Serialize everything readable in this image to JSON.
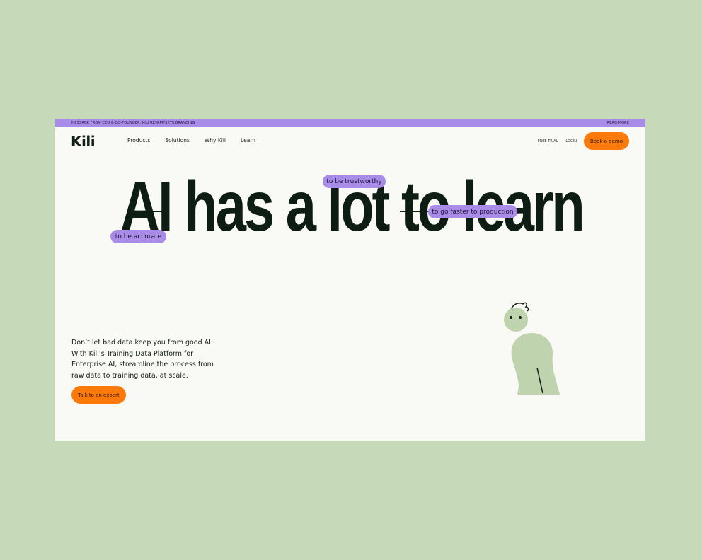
{
  "announcement": {
    "message": "MESSAGE FROM CEO & CO-FOUNDER: KILI REVAMPS ITS BRANDING",
    "link": "READ MORE"
  },
  "nav": {
    "logo": "Kili",
    "links": [
      "Products",
      "Solutions",
      "Why Kili",
      "Learn"
    ],
    "free_trial": "FREE TRIAL",
    "login": "LOGIN",
    "cta": "Book a demo"
  },
  "hero": {
    "headline": "AI has a lot to learn",
    "tags": {
      "trustworthy": "to be trustworthy",
      "production": "to go faster to production",
      "accurate": "to be accurate"
    },
    "description": "Don’t let bad data keep you from good AI. With Kili’s Training Data Platform for Enterprise AI, streamline the process from raw data to training data, at scale.",
    "cta": "Talk to an expert"
  },
  "illustration": "person-character-illustration",
  "colors": {
    "background": "#c6d9b8",
    "page": "#f9f9f5",
    "accent_purple": "#a98be8",
    "accent_orange": "#fc7a0b",
    "text_dark": "#0e1d14",
    "figure_green": "#bfd4ae"
  }
}
